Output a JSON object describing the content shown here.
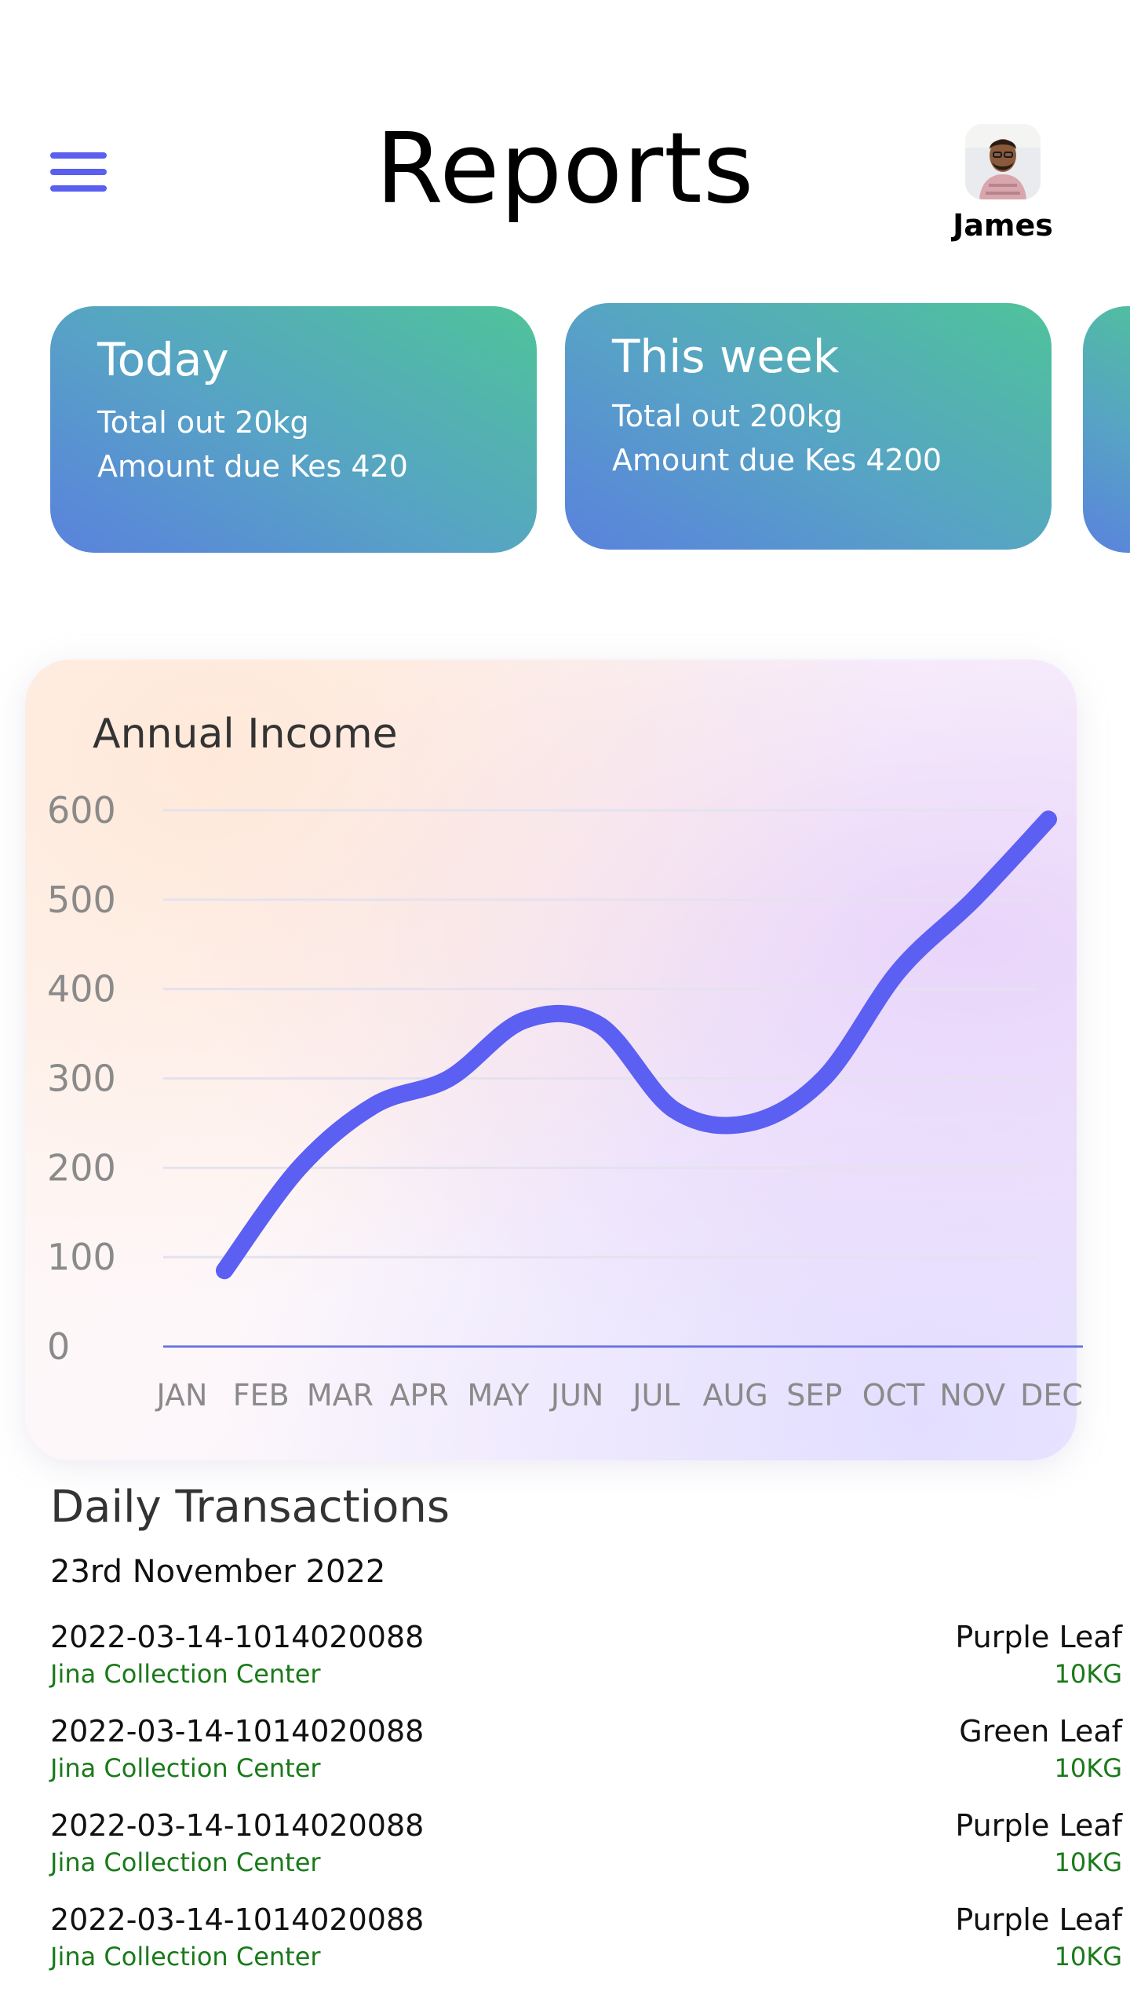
{
  "header": {
    "title": "Reports",
    "user_name": "James",
    "menu_icon": "hamburger-menu-icon"
  },
  "summary_cards": [
    {
      "title": "Today",
      "total_out": "Total out 20kg",
      "amount_due": "Amount due Kes 420"
    },
    {
      "title": "This week",
      "total_out": "Total out 200kg",
      "amount_due": "Amount due Kes 4200"
    }
  ],
  "chart_data": {
    "type": "line",
    "title": "Annual Income",
    "x": [
      "JAN",
      "FEB",
      "MAR",
      "APR",
      "MAY",
      "JUN",
      "JUL",
      "AUG",
      "SEP",
      "OCT",
      "NOV",
      "DEC"
    ],
    "y_ticks": [
      "0",
      "100",
      "200",
      "300",
      "400",
      "500",
      "600"
    ],
    "ylim": [
      0,
      600
    ],
    "grid": true,
    "series": [
      {
        "values": [
          85,
          200,
          270,
          300,
          365,
          360,
          265,
          250,
          300,
          420,
          500,
          590
        ]
      }
    ],
    "line_color": "#5b5ff2"
  },
  "transactions": {
    "section_title": "Daily Transactions",
    "date": "23rd November 2022",
    "items": [
      {
        "id": "2022-03-14-1014020088",
        "center": "Jina Collection Center",
        "type": "Purple Leaf",
        "weight": "10KG"
      },
      {
        "id": "2022-03-14-1014020088",
        "center": "Jina Collection Center",
        "type": "Green Leaf",
        "weight": "10KG"
      },
      {
        "id": "2022-03-14-1014020088",
        "center": "Jina Collection Center",
        "type": "Purple Leaf",
        "weight": "10KG"
      },
      {
        "id": "2022-03-14-1014020088",
        "center": "Jina Collection Center",
        "type": "Purple Leaf",
        "weight": "10KG"
      }
    ]
  }
}
